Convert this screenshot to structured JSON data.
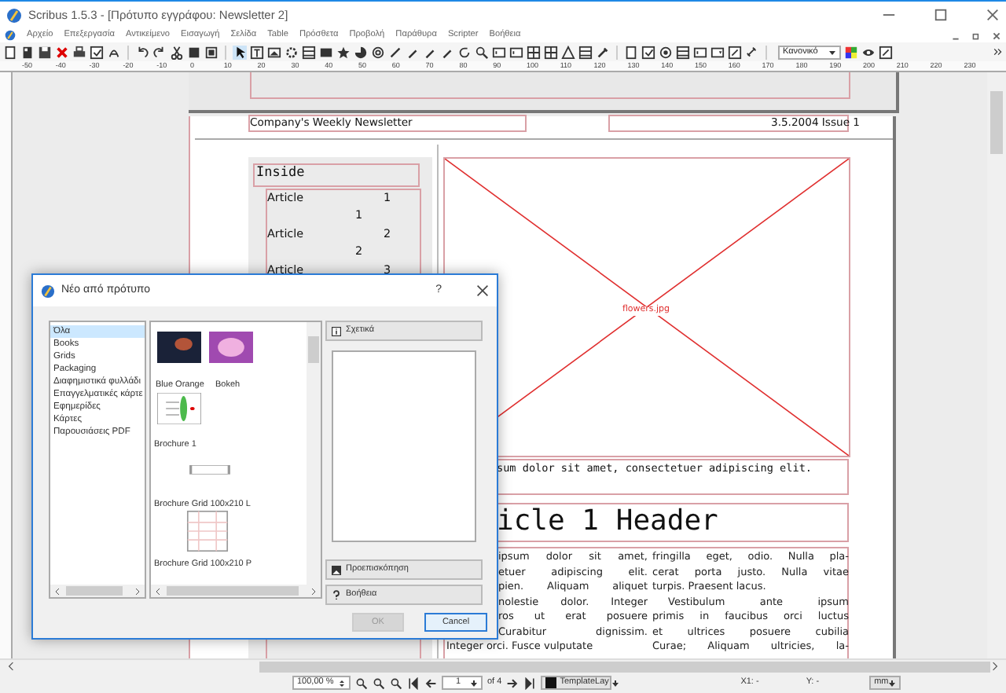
{
  "window": {
    "title": "Scribus 1.5.3 - [Πρότυπο εγγράφου: Newsletter 2]"
  },
  "menu": [
    "Αρχείο",
    "Επεξεργασία",
    "Αντικείμενο",
    "Εισαγωγή",
    "Σελίδα",
    "Table",
    "Πρόσθετα",
    "Προβολή",
    "Παράθυρα",
    "Scripter",
    "Βοήθεια"
  ],
  "toolbar": {
    "style_select": "Κανονικό"
  },
  "ruler": {
    "labels": [
      "-50",
      "-40",
      "-30",
      "-20",
      "-10",
      "0",
      "10",
      "20",
      "30",
      "40",
      "50",
      "60",
      "70",
      "80",
      "90",
      "100",
      "110",
      "120",
      "130",
      "140",
      "150",
      "160",
      "170",
      "180",
      "190",
      "200",
      "210",
      "220",
      "230"
    ]
  },
  "document": {
    "header_left": "Company's Weekly Newsletter",
    "header_right": "3.5.2004 Issue 1",
    "sidebar_title": "Inside",
    "toc": [
      {
        "label": "Article",
        "number": "1",
        "page": "1"
      },
      {
        "label": "Article",
        "number": "2",
        "page": "2"
      },
      {
        "label": "Article",
        "number": "3"
      }
    ],
    "image_name": "flowers.jpg",
    "caption": "sum dolor sit amet, consectetuer adipiscing elit.",
    "headline": "icle 1 Header",
    "column_1": [
      "ipsum dolor sit amet,",
      "etuer adipiscing elit.",
      "pien. Aliquam aliquet",
      "nolestie dolor. Integer",
      "ros ut erat posuere",
      "Curabitur dignissim.",
      "Integer orci. Fusce vulputate"
    ],
    "column_2": [
      "fringilla eget, odio. Nulla pla-",
      "cerat porta justo. Nulla vitae",
      "turpis. Praesent lacus.",
      "Vestibulum ante ipsum",
      "primis in faucibus orci luctus",
      "et ultrices posuere cubilia",
      "Curae; Aliquam ultricies, la-"
    ]
  },
  "dialog": {
    "title": "Νέο από πρότυπο",
    "help": "?",
    "categories": [
      {
        "label": "Όλα",
        "selected": true
      },
      {
        "label": "Books",
        "selected": false
      },
      {
        "label": "Grids",
        "selected": false
      },
      {
        "label": "Packaging",
        "selected": false
      },
      {
        "label": "Διαφημιστικά φυλλάδι",
        "selected": false
      },
      {
        "label": "Επαγγελματικές κάρτε",
        "selected": false
      },
      {
        "label": "Εφημερίδες",
        "selected": false
      },
      {
        "label": "Κάρτες",
        "selected": false
      },
      {
        "label": "Παρουσιάσεις PDF",
        "selected": false
      }
    ],
    "templates": [
      {
        "label": "Blue Orange",
        "kind": "night"
      },
      {
        "label": "Bokeh",
        "kind": "bokeh"
      },
      {
        "label": "Brochure 1",
        "kind": "brochure"
      },
      {
        "label": "Brochure Grid 100x210 L",
        "kind": "landscape"
      },
      {
        "label": "Brochure Grid 100x210 P",
        "kind": "portrait"
      }
    ],
    "about_button": "Σχετικά",
    "preview_button": "Προεπισκόπηση",
    "help_button": "Βοήθεια",
    "ok": {
      "label": "OK",
      "disabled": true
    },
    "cancel": {
      "label": "Cancel",
      "disabled": false
    }
  },
  "status_bar": {
    "zoom": "100,00 %",
    "page": "1",
    "page_count": "of 4",
    "layer": "TemplateLay",
    "x": "X1: -",
    "y": "Y: -",
    "unit": "mm"
  }
}
